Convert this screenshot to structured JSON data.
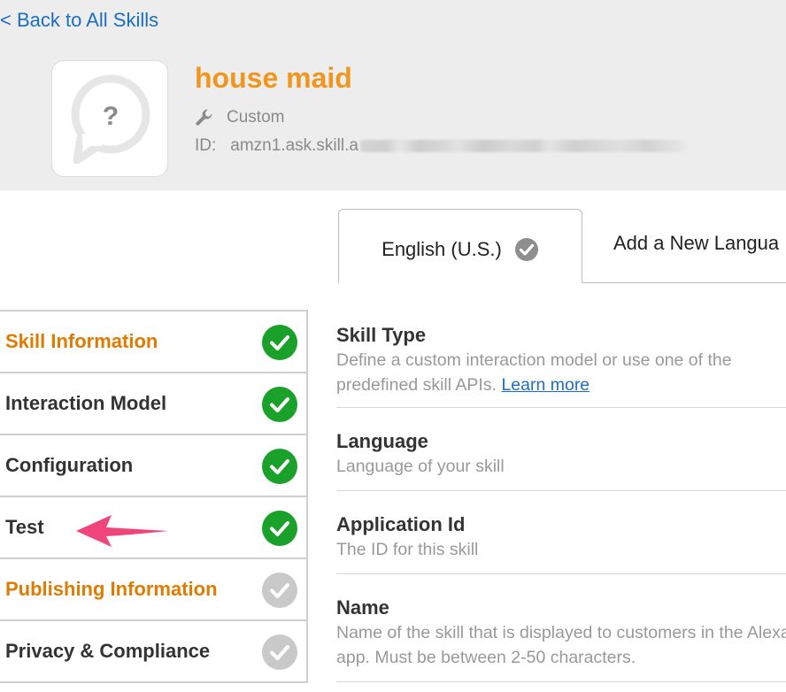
{
  "header": {
    "back_link": "< Back to All Skills",
    "skill_icon": "question-mark-bubble-icon",
    "skill_name": "house maid",
    "skill_type_icon": "wrench-icon",
    "skill_type": "Custom",
    "id_label": "ID:",
    "id_value_visible": "amzn1.ask.skill.a"
  },
  "language_tabs": [
    {
      "label": "English (U.S.)",
      "active": true,
      "icon": "check-circle-icon"
    },
    {
      "label": "Add a New Langua",
      "active": false
    }
  ],
  "sidebar": {
    "items": [
      {
        "label": "Skill Information",
        "status": "complete",
        "highlight": true
      },
      {
        "label": "Interaction Model",
        "status": "complete",
        "highlight": false
      },
      {
        "label": "Configuration",
        "status": "complete",
        "highlight": false
      },
      {
        "label": "Test",
        "status": "complete",
        "highlight": false
      },
      {
        "label": "Publishing Information",
        "status": "incomplete",
        "highlight": true
      },
      {
        "label": "Privacy & Compliance",
        "status": "incomplete",
        "highlight": false
      }
    ]
  },
  "annotation": {
    "icon": "pink-arrow-icon",
    "color": "#f0457a"
  },
  "content": {
    "fields": [
      {
        "title": "Skill Type",
        "desc": "Define a custom interaction model or use one of the predefined skill APIs.",
        "link": "Learn more"
      },
      {
        "title": "Language",
        "desc": "Language of your skill"
      },
      {
        "title": "Application Id",
        "desc": "The ID for this skill"
      },
      {
        "title": "Name",
        "desc": "Name of the skill that is displayed to customers in the Alexa app. Must be between 2-50 characters."
      }
    ]
  },
  "colors": {
    "accent_orange": "#f0961e",
    "nav_orange": "#e07b00",
    "link_blue": "#1a6fc4",
    "check_green": "#1aa12a",
    "check_gray": "#c9c9c9"
  }
}
